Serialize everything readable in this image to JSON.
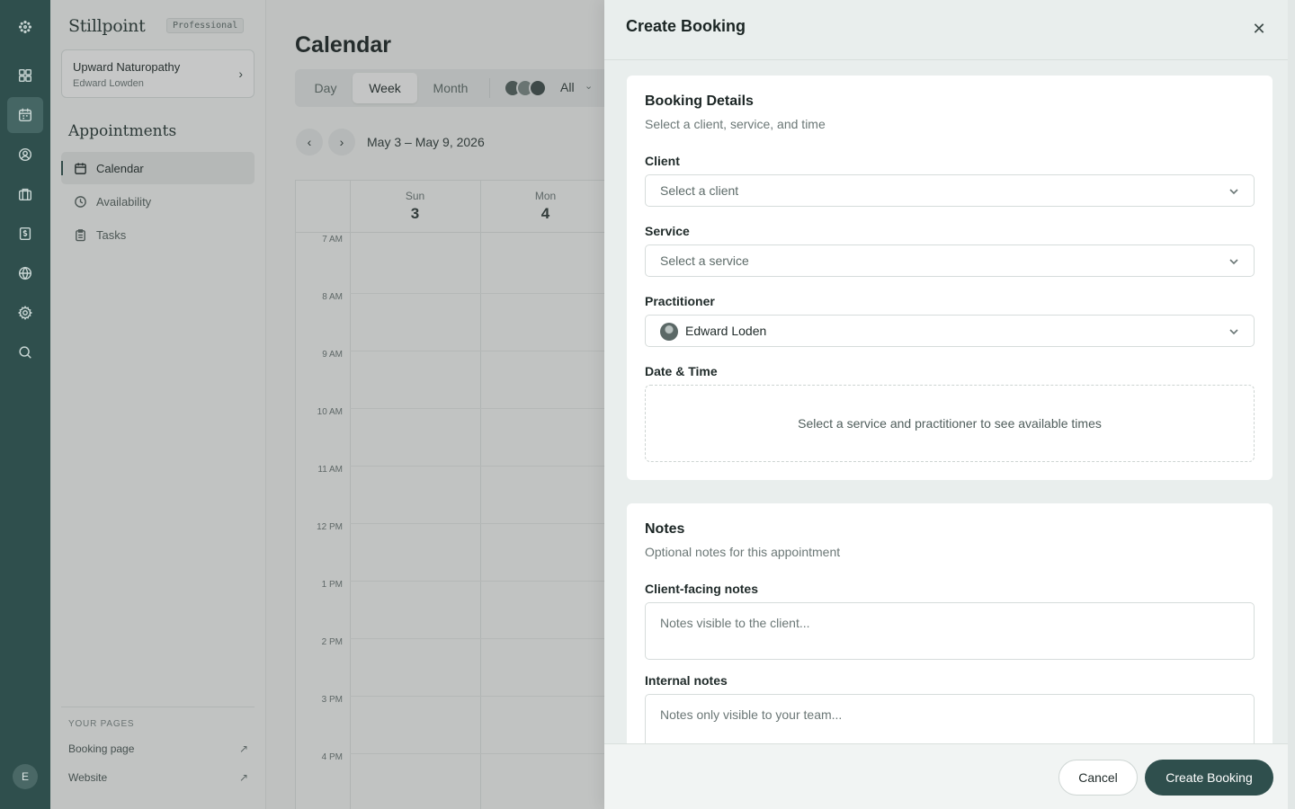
{
  "sidebar": {
    "brand": "Stillpoint",
    "plan_badge": "Professional",
    "org_name": "Upward Naturopathy",
    "org_user": "Edward Lowden",
    "section_title": "Appointments",
    "nav": [
      {
        "label": "Calendar",
        "icon": "calendar-icon",
        "active": true
      },
      {
        "label": "Availability",
        "icon": "clock-icon",
        "active": false
      },
      {
        "label": "Tasks",
        "icon": "clipboard-icon",
        "active": false
      }
    ],
    "pages_label": "YOUR PAGES",
    "page_links": [
      {
        "label": "Booking page",
        "icon": "external-link-icon"
      },
      {
        "label": "Website",
        "icon": "external-link-icon"
      }
    ],
    "user_initial": "E"
  },
  "rail_icons": [
    "logo-icon",
    "dashboard-icon",
    "calendar-icon",
    "clients-icon",
    "briefcase-icon",
    "invoice-icon",
    "globe-icon",
    "settings-icon",
    "search-icon"
  ],
  "calendar": {
    "title": "Calendar",
    "views": [
      "Day",
      "Week",
      "Month"
    ],
    "active_view": "Week",
    "practitioner_filter": "All",
    "date_range": "May 3 – May 9, 2026",
    "days": [
      {
        "name": "Sun",
        "num": "3"
      },
      {
        "name": "Mon",
        "num": "4"
      }
    ],
    "hours": [
      "7 AM",
      "8 AM",
      "9 AM",
      "10 AM",
      "11 AM",
      "12 PM",
      "1 PM",
      "2 PM",
      "3 PM",
      "4 PM"
    ]
  },
  "drawer": {
    "title": "Create Booking",
    "details": {
      "title": "Booking Details",
      "subtitle": "Select a client, service, and time",
      "client_label": "Client",
      "client_placeholder": "Select a client",
      "service_label": "Service",
      "service_placeholder": "Select a service",
      "practitioner_label": "Practitioner",
      "practitioner_value": "Edward Loden",
      "datetime_label": "Date & Time",
      "datetime_hint": "Select a service and practitioner to see available times"
    },
    "notes": {
      "title": "Notes",
      "subtitle": "Optional notes for this appointment",
      "client_label": "Client-facing notes",
      "client_placeholder": "Notes visible to the client...",
      "internal_label": "Internal notes",
      "internal_placeholder": "Notes only visible to your team..."
    },
    "cancel_label": "Cancel",
    "create_label": "Create Booking"
  },
  "colors": {
    "brand_dark": "#2f4f4d",
    "overlay": "#3c403f"
  }
}
